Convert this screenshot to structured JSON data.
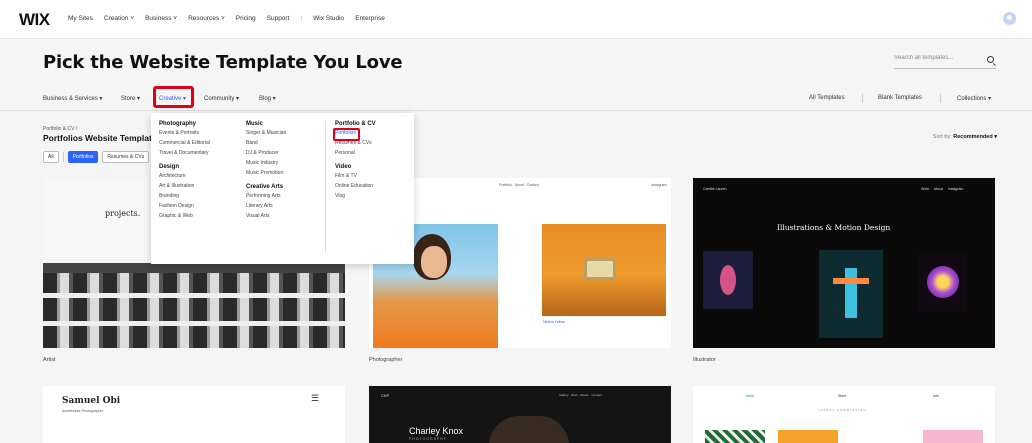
{
  "topbar": {
    "logo": "WIX",
    "nav": [
      "My Sites",
      "Creation ˅",
      "Business ˅",
      "Resources ˅",
      "Pricing",
      "Support",
      "|",
      "Wix Studio",
      "Enterprise"
    ]
  },
  "page": {
    "headline": "Pick the Website Template You Love",
    "search_placeholder": "Search all templates..."
  },
  "categories": {
    "business": "Business & Services ▾",
    "store": "Store ▾",
    "creative": "Creative ▾",
    "community": "Community ▾",
    "blog": "Blog ▾",
    "all_templates": "All Templates",
    "blank_templates": "Blank Templates",
    "collections": "Collections ▾"
  },
  "section": {
    "breadcrumb": "Portfolio & CV /",
    "title": "Portfolios Website Templates",
    "chips": [
      "All",
      "Portfolios",
      "Resumes & CVs"
    ],
    "sort_label": "Sort by:",
    "sort_value": "Recommended ▾"
  },
  "dropdown": {
    "photography": {
      "heading": "Photography",
      "items": [
        "Events & Portraits",
        "Commercial & Editorial",
        "Travel & Documentary"
      ]
    },
    "design": {
      "heading": "Design",
      "items": [
        "Architecture",
        "Art & Illustration",
        "Branding",
        "Fashion Design",
        "Graphic & Web"
      ]
    },
    "music": {
      "heading": "Music",
      "items": [
        "Singer & Musician",
        "Band",
        "DJ & Producer",
        "Music Industry",
        "Music Promotion"
      ]
    },
    "creative_arts": {
      "heading": "Creative Arts",
      "items": [
        "Performing Arts",
        "Literary Arts",
        "Visual Arts"
      ]
    },
    "portfolio_cv": {
      "heading": "Portfolio & CV",
      "items": [
        "Portfolios",
        "Resumes & CVs",
        "Personal"
      ]
    },
    "video": {
      "heading": "Video",
      "items": [
        "Film & TV",
        "Online Education",
        "Vlog"
      ]
    }
  },
  "cards": {
    "artist": {
      "label": "Artist",
      "text": "projects."
    },
    "photographer": {
      "label": "Photographer",
      "nav": "Portfolio   About   Contact",
      "brand": "Instagram",
      "caption": "Mellow Yellow"
    },
    "illustrator": {
      "label": "Illustrator",
      "brand": "Camille Lauren",
      "nav": "Work     About     Instagram",
      "title": "Illustrations & Motion Design"
    },
    "samuel": {
      "name": "Samuel Obi",
      "sub": "Architecture Photographer"
    },
    "charley": {
      "name": "Charley Knox",
      "sub": "PHOTOGRAPHY",
      "brand": "CKP",
      "nav": "Gallery   Work   Books   Contact"
    },
    "shop": {
      "nav": [
        "Work",
        "Store",
        "Info"
      ],
      "banner": "LATEST COMMISSION"
    }
  },
  "colors": {
    "accent": "#2e62ff",
    "highlight": "#e0001a"
  }
}
